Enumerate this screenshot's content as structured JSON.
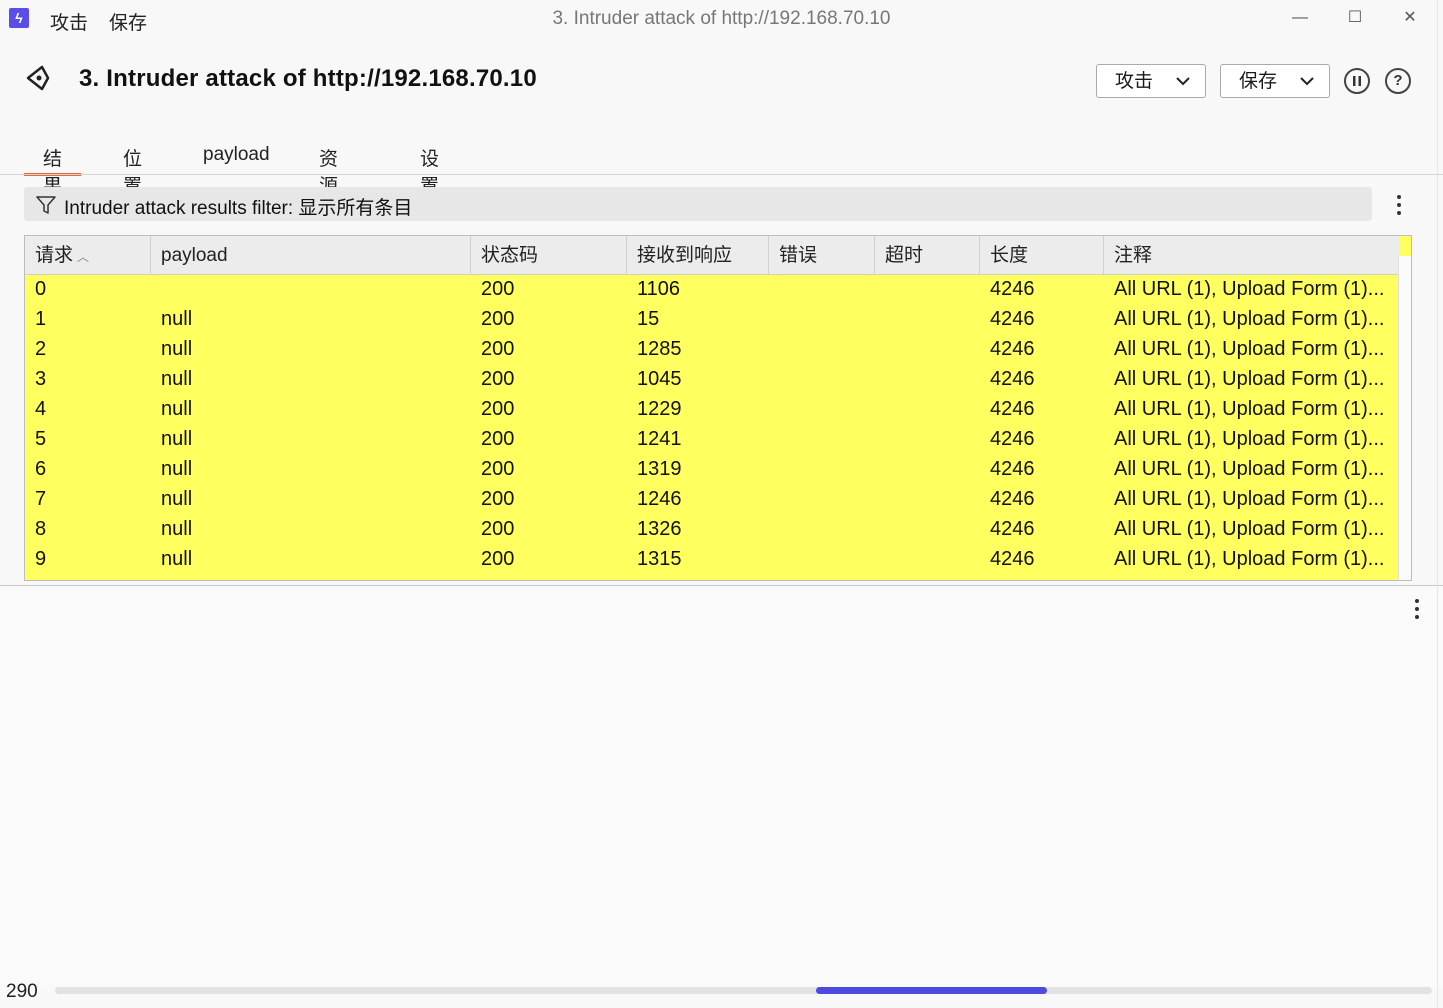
{
  "window": {
    "menu": [
      "攻击",
      "保存"
    ],
    "title": "3. Intruder attack of http://192.168.70.10",
    "controls": {
      "minimize": "—",
      "maximize": "☐",
      "close": "✕"
    }
  },
  "header": {
    "title": "3. Intruder attack of http://192.168.70.10",
    "attack_button": "攻击",
    "save_button": "保存",
    "pause_icon": "pause-circle-icon",
    "help_icon": "help-circle-icon"
  },
  "tabs": [
    "结果",
    "位置",
    "payload",
    "资源池",
    "设置"
  ],
  "active_tab": "结果",
  "filter": {
    "text": "Intruder attack results filter: 显示所有条目"
  },
  "table": {
    "columns": [
      "请求",
      "payload",
      "状态码",
      "接收到响应",
      "错误",
      "超时",
      "长度",
      "注释"
    ],
    "sort_column": "请求",
    "row_color": "#ffff60",
    "rows": [
      {
        "request": "0",
        "payload": "",
        "status": "200",
        "received": "1106",
        "error": "",
        "timeout": "",
        "length": "4246",
        "comment": "All URL (1), Upload Form (1)..."
      },
      {
        "request": "1",
        "payload": "null",
        "status": "200",
        "received": "15",
        "error": "",
        "timeout": "",
        "length": "4246",
        "comment": "All URL (1), Upload Form (1)..."
      },
      {
        "request": "2",
        "payload": "null",
        "status": "200",
        "received": "1285",
        "error": "",
        "timeout": "",
        "length": "4246",
        "comment": "All URL (1), Upload Form (1)..."
      },
      {
        "request": "3",
        "payload": "null",
        "status": "200",
        "received": "1045",
        "error": "",
        "timeout": "",
        "length": "4246",
        "comment": "All URL (1), Upload Form (1)..."
      },
      {
        "request": "4",
        "payload": "null",
        "status": "200",
        "received": "1229",
        "error": "",
        "timeout": "",
        "length": "4246",
        "comment": "All URL (1), Upload Form (1)..."
      },
      {
        "request": "5",
        "payload": "null",
        "status": "200",
        "received": "1241",
        "error": "",
        "timeout": "",
        "length": "4246",
        "comment": "All URL (1), Upload Form (1)..."
      },
      {
        "request": "6",
        "payload": "null",
        "status": "200",
        "received": "1319",
        "error": "",
        "timeout": "",
        "length": "4246",
        "comment": "All URL (1), Upload Form (1)..."
      },
      {
        "request": "7",
        "payload": "null",
        "status": "200",
        "received": "1246",
        "error": "",
        "timeout": "",
        "length": "4246",
        "comment": "All URL (1), Upload Form (1)..."
      },
      {
        "request": "8",
        "payload": "null",
        "status": "200",
        "received": "1326",
        "error": "",
        "timeout": "",
        "length": "4246",
        "comment": "All URL (1), Upload Form (1)..."
      },
      {
        "request": "9",
        "payload": "null",
        "status": "200",
        "received": "1315",
        "error": "",
        "timeout": "",
        "length": "4246",
        "comment": "All URL (1), Upload Form (1)..."
      }
    ]
  },
  "status": {
    "count": "290"
  },
  "colors": {
    "accent": "#5b4ee8",
    "tab_underline": "#e06a3b",
    "scroll_thumb": "#4d4ae0"
  }
}
